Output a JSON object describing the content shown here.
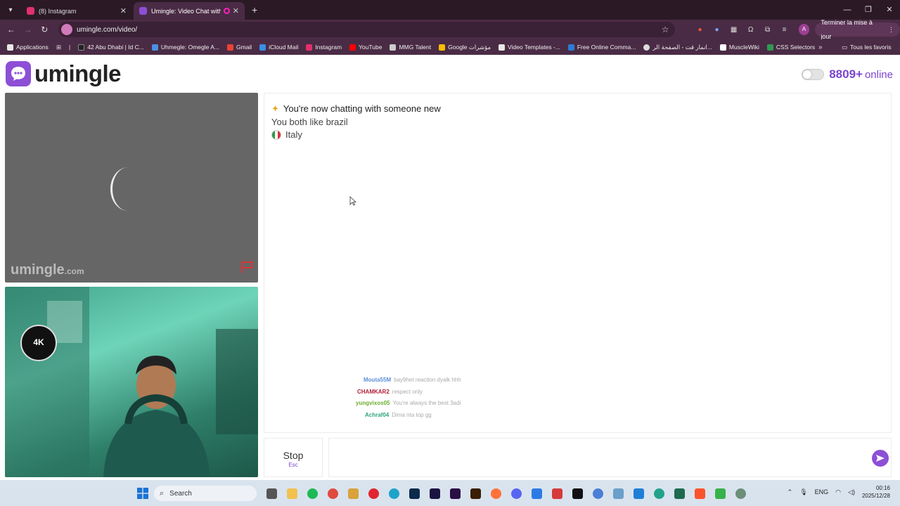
{
  "browser": {
    "tabs": [
      {
        "label": "(8) Instagram",
        "color": "#e1306c"
      },
      {
        "label": "Umingle: Video Chat with S",
        "color": "#8c4fd6"
      }
    ],
    "url": "umingle.com/video/",
    "update_button": "Terminer la mise à jour",
    "profile_initial": "A",
    "bookmarks": [
      {
        "label": "Applications",
        "color": "#e8e8e8"
      },
      {
        "label": "42 Abu Dhabi | Id C...",
        "color": "#222222"
      },
      {
        "label": "Uhmegle: Omegle A...",
        "color": "#4a90e2"
      },
      {
        "label": "Gmail",
        "color": "#ea4335"
      },
      {
        "label": "iCloud Mail",
        "color": "#3a8ee6"
      },
      {
        "label": "Instagram",
        "color": "#e1306c"
      },
      {
        "label": "YouTube",
        "color": "#ff0000"
      },
      {
        "label": "MMG Talent",
        "color": "#cccccc"
      },
      {
        "label": "Google مؤشرات",
        "color": "#fbbc05"
      },
      {
        "label": "Video Templates -...",
        "color": "#e8e8e8"
      },
      {
        "label": "Free Online Comma...",
        "color": "#2b7bd6"
      },
      {
        "label": "انمار قت - الصفحة الر...",
        "color": "#dddddd"
      },
      {
        "label": "MuscleWiki",
        "color": "#ffffff"
      },
      {
        "label": "CSS Selectors",
        "color": "#2e9b4f"
      }
    ],
    "all_bookmarks": "Tous les favoris"
  },
  "site": {
    "name": "umingle",
    "online_count": "8809+",
    "online_label": "online",
    "accent": "#7a45d0"
  },
  "stranger_video": {
    "watermark": "umingle",
    "watermark_suffix": ".com"
  },
  "self_video": {
    "overlay_logo": "4K"
  },
  "chat": {
    "messages": [
      "You're now chatting with someone new",
      "You both like brazil",
      "Italy"
    ],
    "stream_chat": [
      {
        "user": "Mouta55M",
        "color": "#5b8fd6",
        "text": "bay9het reaction dyalk hhh"
      },
      {
        "user": "CHAMKAR2",
        "color": "#b0203a",
        "text": "respect only"
      },
      {
        "user": "yungvixos05",
        "color": "#6cab2e",
        "text": "You're always the best 3adi"
      },
      {
        "user": "Achraf04",
        "color": "#2fa47a",
        "text": "Dima nta top gg"
      }
    ]
  },
  "controls": {
    "stop_label": "Stop",
    "stop_key": "Esc",
    "input_placeholder": ""
  },
  "taskbar": {
    "search_label": "Search",
    "language": "ENG",
    "time": "00:16",
    "date": "2025/12/28"
  }
}
